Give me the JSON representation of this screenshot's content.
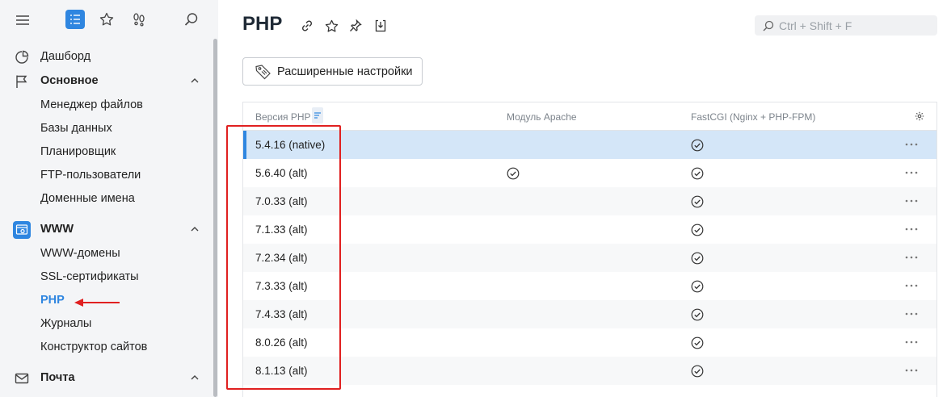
{
  "sidebar": {
    "items": [
      {
        "label": "Дашборд"
      },
      {
        "label": "Основное"
      },
      {
        "label": "Менеджер файлов"
      },
      {
        "label": "Базы данных"
      },
      {
        "label": "Планировщик"
      },
      {
        "label": "FTP-пользователи"
      },
      {
        "label": "Доменные имена"
      },
      {
        "label": "WWW"
      },
      {
        "label": "WWW-домены"
      },
      {
        "label": "SSL-сертификаты"
      },
      {
        "label": "PHP"
      },
      {
        "label": "Журналы"
      },
      {
        "label": "Конструктор сайтов"
      },
      {
        "label": "Почта"
      }
    ]
  },
  "header": {
    "title": "PHP",
    "search_placeholder": "Ctrl + Shift + F"
  },
  "toolbar": {
    "advanced_label": "Расширенные настройки"
  },
  "table": {
    "columns": [
      "Версия PHP",
      "Модуль Apache",
      "FastCGI (Nginx + PHP-FPM)"
    ],
    "rows": [
      {
        "version": "5.4.16 (native)",
        "apache": false,
        "fastcgi": true,
        "selected": true
      },
      {
        "version": "5.6.40 (alt)",
        "apache": true,
        "fastcgi": true,
        "selected": false
      },
      {
        "version": "7.0.33 (alt)",
        "apache": false,
        "fastcgi": true,
        "selected": false
      },
      {
        "version": "7.1.33 (alt)",
        "apache": false,
        "fastcgi": true,
        "selected": false
      },
      {
        "version": "7.2.34 (alt)",
        "apache": false,
        "fastcgi": true,
        "selected": false
      },
      {
        "version": "7.3.33 (alt)",
        "apache": false,
        "fastcgi": true,
        "selected": false
      },
      {
        "version": "7.4.33 (alt)",
        "apache": false,
        "fastcgi": true,
        "selected": false
      },
      {
        "version": "8.0.26 (alt)",
        "apache": false,
        "fastcgi": true,
        "selected": false
      },
      {
        "version": "8.1.13 (alt)",
        "apache": false,
        "fastcgi": true,
        "selected": false
      }
    ]
  },
  "colors": {
    "accent": "#2f86e0",
    "selected_row": "#d4e6f8",
    "annotation_red": "#e02020"
  }
}
